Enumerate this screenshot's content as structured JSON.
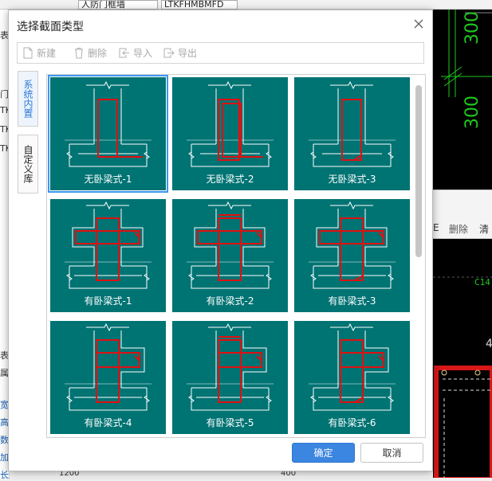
{
  "background": {
    "combo_1": "人防门框墙",
    "combo_2": "LTKFHMBMFD",
    "left_chars": [
      "表",
      "门",
      "TK",
      "TK",
      "TK"
    ],
    "left_bottom_chars": [
      "表",
      "属",
      "宽",
      "高",
      "数",
      "加",
      "长度"
    ],
    "right_toolbar": {
      "delete": "删除",
      "clear": "清"
    },
    "right_labels": {
      "c14": "C14",
      "num_4": "4",
      "num_300a": "300",
      "num_300b": "300"
    },
    "bottom_values": {
      "v1": "1200",
      "v2": "400"
    }
  },
  "dialog": {
    "title": "选择截面类型",
    "close_icon": "close-icon",
    "toolbar": {
      "new": "新建",
      "delete": "删除",
      "import": "导入",
      "export": "导出"
    },
    "tabs": {
      "builtin": "系统内置",
      "custom": "自定义库"
    },
    "tiles": [
      {
        "label": "无卧梁式-1",
        "kind": "none",
        "variant": 1
      },
      {
        "label": "无卧梁式-2",
        "kind": "none",
        "variant": 2
      },
      {
        "label": "无卧梁式-3",
        "kind": "none",
        "variant": 3
      },
      {
        "label": "有卧梁式-1",
        "kind": "cross",
        "variant": 1
      },
      {
        "label": "有卧梁式-2",
        "kind": "cross",
        "variant": 2
      },
      {
        "label": "有卧梁式-3",
        "kind": "cross",
        "variant": 3
      },
      {
        "label": "有卧梁式-4",
        "kind": "side",
        "variant": 1
      },
      {
        "label": "有卧梁式-5",
        "kind": "side",
        "variant": 2
      },
      {
        "label": "有卧梁式-6",
        "kind": "side",
        "variant": 3
      }
    ],
    "selected_index": 0,
    "buttons": {
      "ok": "确定",
      "cancel": "取消"
    },
    "colors": {
      "tile_bg": "#007373",
      "rebar": "#e01010",
      "outline": "#ffffff",
      "accent": "#3b86e0",
      "selection": "#3c97f0"
    }
  }
}
